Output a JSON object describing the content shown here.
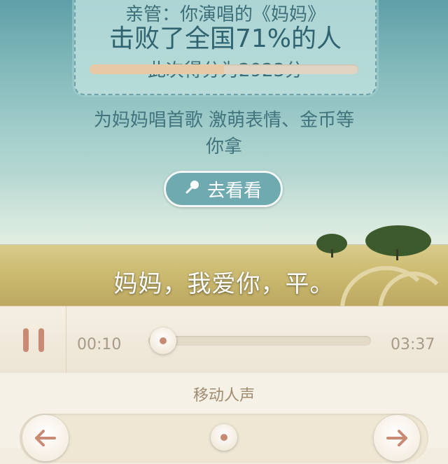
{
  "result_card": {
    "top_line": "亲管：你演唱的《妈妈》",
    "beat_line": "击败了全国71%的人",
    "score_line": "此次得分为2923分"
  },
  "promo": {
    "line1": "为妈妈唱首歌 激萌表情、金币等",
    "line2": "你拿"
  },
  "go_button": {
    "label": "去看看",
    "icon": "microphone-icon"
  },
  "lyric": "妈妈，我爱你，平。",
  "player": {
    "state": "playing",
    "current_time": "00:10",
    "total_time": "03:37",
    "progress": 0.046
  },
  "voice_panel": {
    "title": "移动人声",
    "offset": 0.5,
    "left_icon": "arrow-left-icon",
    "right_icon": "arrow-right-icon"
  },
  "colors": {
    "accent": "#c98a74",
    "teal": "#6eaab0",
    "text_teal": "#3d6f79"
  }
}
